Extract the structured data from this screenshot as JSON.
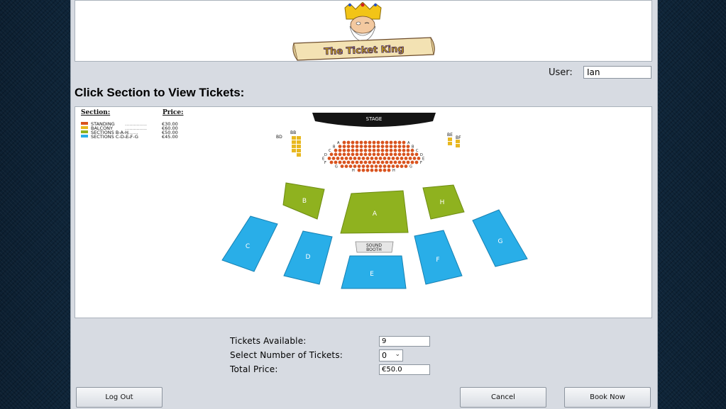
{
  "logo": {
    "banner_text": "The Ticket King"
  },
  "header": {
    "user_label": "User:",
    "user_value": "Ian"
  },
  "page_title": "Click Section to View Tickets:",
  "legend": {
    "section_header": "Section:",
    "price_header": "Price:",
    "items": [
      {
        "label": "STANDING",
        "dots": "...............",
        "price": "€30.00",
        "color": "#d9531e"
      },
      {
        "label": "BALCONY",
        "dots": "...............",
        "price": "€60.00",
        "color": "#e8b820"
      },
      {
        "label": "SECTIONS B-A-H",
        "dots": ".........",
        "price": "€50.00",
        "color": "#8fb21f"
      },
      {
        "label": "SECTIONS C-D-E-F-G",
        "dots": "....",
        "price": "€45.00",
        "color": "#29aee8"
      }
    ]
  },
  "seatmap": {
    "stage_label": "STAGE",
    "sound_booth_label": "SOUND BOOTH",
    "sections": [
      {
        "id": "A",
        "tier": "B-A-H"
      },
      {
        "id": "B",
        "tier": "B-A-H"
      },
      {
        "id": "H",
        "tier": "B-A-H"
      },
      {
        "id": "C",
        "tier": "C-D-E-F-G"
      },
      {
        "id": "D",
        "tier": "C-D-E-F-G"
      },
      {
        "id": "E",
        "tier": "C-D-E-F-G"
      },
      {
        "id": "F",
        "tier": "C-D-E-F-G"
      },
      {
        "id": "G",
        "tier": "C-D-E-F-G"
      }
    ],
    "balcony_left_labels": [
      "BD",
      "BB"
    ],
    "balcony_right_labels": [
      "BE",
      "BF"
    ],
    "row_labels_left": [
      "A",
      "B",
      "C",
      "D",
      "E",
      "F",
      "G",
      "H"
    ],
    "row_labels_right": [
      "A",
      "B",
      "C",
      "D",
      "E",
      "F",
      "G",
      "H"
    ]
  },
  "form": {
    "tickets_available_label": "Tickets Available:",
    "tickets_available_value": "9",
    "select_tickets_label": "Select Number of Tickets:",
    "select_tickets_value": "0",
    "total_price_label": "Total Price:",
    "total_price_value": "€50.0"
  },
  "buttons": {
    "logout": "Log Out",
    "cancel": "Cancel",
    "book_now": "Book Now"
  }
}
